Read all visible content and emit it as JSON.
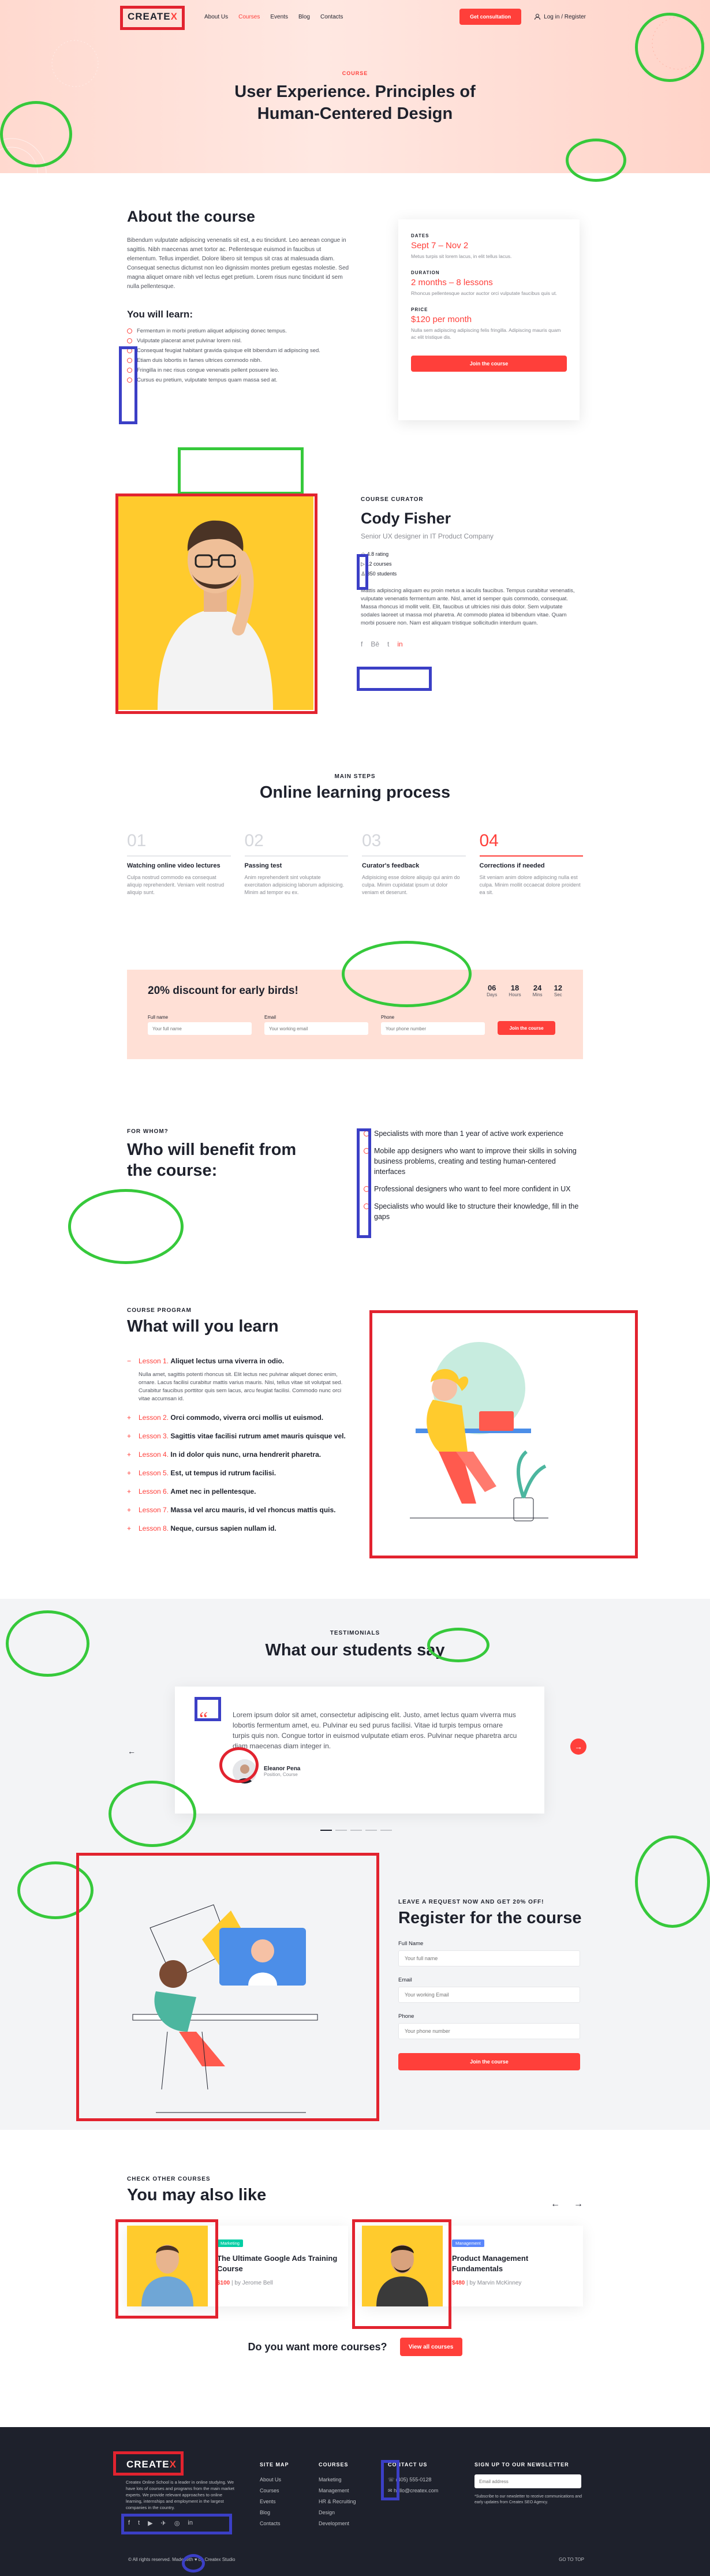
{
  "nav": {
    "logo_main": "CREATE",
    "logo_x": "X",
    "items": [
      "About Us",
      "Courses",
      "Events",
      "Blog",
      "Contacts"
    ],
    "active_index": 1,
    "consult_button": "Get consultation",
    "login": "Log in / Register"
  },
  "hero": {
    "label": "COURSE",
    "title": "User Experience. Principles of Human-Centered Design"
  },
  "about": {
    "title": "About the course",
    "body": "Bibendum vulputate adipiscing venenatis sit est, a eu tincidunt. Leo aenean congue in sagittis. Nibh maecenas amet tortor ac. Pellentesque euismod in faucibus ut elementum. Tellus imperdiet. Dolore libero sit tempus sit cras at malesuada diam. Consequat senectus dictumst non leo dignissim montes pretium egestas molestie. Sed magna aliquet ornare nibh vel lectus eget pretium. Lorem risus nunc tincidunt id sem nulla pellentesque.",
    "learn_title": "You will learn:",
    "learn_items": [
      "Fermentum in morbi pretium aliquet adipiscing donec tempus.",
      "Vulputate placerat amet pulvinar lorem nisl.",
      "Consequat feugiat habitant gravida quisque elit bibendum id adipiscing sed.",
      "Etiam duis lobortis in fames ultrices commodo nibh.",
      "Fringilla in nec risus congue venenatis pellent posuere leo.",
      "Cursus eu pretium, vulputate tempus quam massa sed at."
    ]
  },
  "card": {
    "dates_label": "DATES",
    "dates_value": "Sept 7 – Nov 2",
    "dates_note": "Metus turpis sit lorem lacus, in elit tellus lacus.",
    "duration_label": "DURATION",
    "duration_value": "2 months – 8 lessons",
    "duration_note": "Rhoncus pellentesque auctor auctor orci vulputate faucibus quis ut.",
    "price_label": "PRICE",
    "price_value": "$120 per month",
    "price_note": "Nulla sem adipiscing adipiscing felis fringilla. Adipiscing mauris quam ac elit tristique dis.",
    "button": "Join the course"
  },
  "curator": {
    "label": "COURSE CURATOR",
    "name": "Cody Fisher",
    "title": "Senior UX designer in IT Product Company",
    "stats": [
      "4.8 Rating",
      "12 Courses",
      "350 Students"
    ],
    "stat_values": [
      "4.8",
      "12",
      "350"
    ],
    "stat_labels": [
      "rating",
      "courses",
      "students"
    ],
    "bio": "Mattis adipiscing aliquam eu proin metus a iaculis faucibus. Tempus curabitur venenatis, vulputate venenatis fermentum ante. Nisl, amet id semper quis commodo, consequat. Massa rhoncus id mollit velit. Elit, faucibus ut ultricies nisi duis dolor. Sem vulputate sodales laoreet ut massa mol pharetra. At commodo platea id bibendum vitae. Quam morbi posuere non. Nam est aliquam tristique sollicitudin interdum quam."
  },
  "steps": {
    "label": "MAIN STEPS",
    "title": "Online learning process",
    "items": [
      {
        "num": "01",
        "title": "Watching online video lectures",
        "desc": "Culpa nostrud commodo ea consequat aliquip reprehenderit. Veniam velit nostrud aliquip sunt."
      },
      {
        "num": "02",
        "title": "Passing test",
        "desc": "Anim reprehenderit sint voluptate exercitation adipisicing laborum adipisicing. Minim ad tempor eu ex."
      },
      {
        "num": "03",
        "title": "Curator's feedback",
        "desc": "Adipisicing esse dolore aliquip qui anim do culpa. Minim cupidatat ipsum ut dolor veniam et deserunt."
      },
      {
        "num": "04",
        "title": "Corrections if needed",
        "desc": "Sit veniam anim dolore adipiscing nulla est culpa. Minim mollit occaecat dolore proident ea sit."
      }
    ]
  },
  "discount": {
    "title": "20% discount for early birds!",
    "timer": [
      {
        "v": "06",
        "l": "Days"
      },
      {
        "v": "18",
        "l": "Hours"
      },
      {
        "v": "24",
        "l": "Mins"
      },
      {
        "v": "12",
        "l": "Sec"
      }
    ],
    "name_label": "Full name",
    "name_placeholder": "Your full name",
    "email_label": "Email",
    "email_placeholder": "Your working email",
    "phone_label": "Phone",
    "phone_placeholder": "Your phone number",
    "button": "Join the course"
  },
  "benefit": {
    "label": "FOR WHOM?",
    "title": "Who will benefit from the course:",
    "items": [
      "Specialists with more than 1 year of active work experience",
      "Mobile app designers who want to improve their skills in solving business problems, creating and testing human-centered interfaces",
      "Professional designers who want to feel more confident in UX",
      "Specialists who would like to structure their knowledge, fill in the gaps"
    ]
  },
  "program": {
    "label": "COURSE PROGRAM",
    "title": "What will you learn",
    "lessons": [
      {
        "n": "Lesson 1.",
        "t": "Aliquet lectus urna viverra in odio.",
        "open": true
      },
      {
        "n": "Lesson 2.",
        "t": "Orci commodo, viverra orci mollis ut euismod."
      },
      {
        "n": "Lesson 3.",
        "t": "Sagittis vitae facilisi rutrum amet mauris quisque vel."
      },
      {
        "n": "Lesson 4.",
        "t": "In id dolor quis nunc, urna hendrerit pharetra."
      },
      {
        "n": "Lesson 5.",
        "t": "Est, ut tempus id rutrum facilisi."
      },
      {
        "n": "Lesson 6.",
        "t": "Amet nec in pellentesque."
      },
      {
        "n": "Lesson 7.",
        "t": "Massa vel arcu mauris, id vel rhoncus mattis quis."
      },
      {
        "n": "Lesson 8.",
        "t": "Neque, cursus sapien nullam id."
      }
    ],
    "lesson1_body": "Nulla amet, sagittis potenti rhoncus sit. Elit lectus nec pulvinar aliquet donec enim, ornare. Lacus facilisi curabitur mattis varius mauris. Nisi, tellus vitae sit volutpat sed. Curabitur faucibus porttitor quis sem lacus, arcu feugiat facilisi. Commodo nunc orci vitae accumsan id."
  },
  "testimonials": {
    "label": "TESTIMONIALS",
    "title": "What our students say",
    "quote": "Lorem ipsum dolor sit amet, consectetur adipiscing elit. Justo, amet lectus quam viverra mus lobortis fermentum amet, eu. Pulvinar eu sed purus facilisi. Vitae id turpis tempus ornare turpis quis non. Congue tortor in euismod vulputate etiam eros. Pulvinar neque pharetra arcu diam maecenas diam integer in.",
    "author": "Eleanor Pena",
    "role": "Position, Course"
  },
  "register": {
    "label": "LEAVE A REQUEST NOW AND GET 20% OFF!",
    "title": "Register for the course",
    "name_label": "Full Name",
    "name_placeholder": "Your full name",
    "email_label": "Email",
    "email_placeholder": "Your working Email",
    "phone_label": "Phone",
    "phone_placeholder": "Your phone number",
    "button": "Join the course"
  },
  "also": {
    "label": "CHECK OTHER COURSES",
    "title": "You may also like",
    "cards": [
      {
        "tag": "Marketing",
        "tag_color": "#03cea4",
        "title": "The Ultimate Google Ads Training Course",
        "price": "$100",
        "author": "| by Jerome Bell"
      },
      {
        "tag": "Management",
        "tag_color": "#5a87fc",
        "title": "Product Management Fundamentals",
        "price": "$480",
        "author": "| by Marvin McKinney"
      }
    ],
    "more_text": "Do you want more courses?",
    "more_button": "View all courses"
  },
  "footer": {
    "logo_main": "CREATE",
    "logo_x": "X",
    "desc": "Createx Online School is a leader in online studying. We have lots of courses and programs from the main market experts. We provide relevant approaches to online learning, internships and employment in the largest companies in the country.",
    "site_map_title": "SITE MAP",
    "site_map": [
      "About Us",
      "Courses",
      "Events",
      "Blog",
      "Contacts"
    ],
    "courses_title": "COURSES",
    "courses": [
      "Marketing",
      "Management",
      "HR & Recruiting",
      "Design",
      "Development"
    ],
    "contact_title": "CONTACT US",
    "phone": "(405) 555-0128",
    "email": "hello@createx.com",
    "news_title": "SIGN UP TO OUR NEWSLETTER",
    "news_placeholder": "Email address",
    "news_note": "*Subscribe to our newsletter to receive communications and early updates from Createx SEO Agency.",
    "copyright": "© All rights reserved. Made with ♥ by Createx Studio",
    "go_top": "GO TO TOP"
  },
  "colors": {
    "accent": "#ff3f3a",
    "hero_bg": "#ffd9cf",
    "dark": "#1e212c"
  }
}
